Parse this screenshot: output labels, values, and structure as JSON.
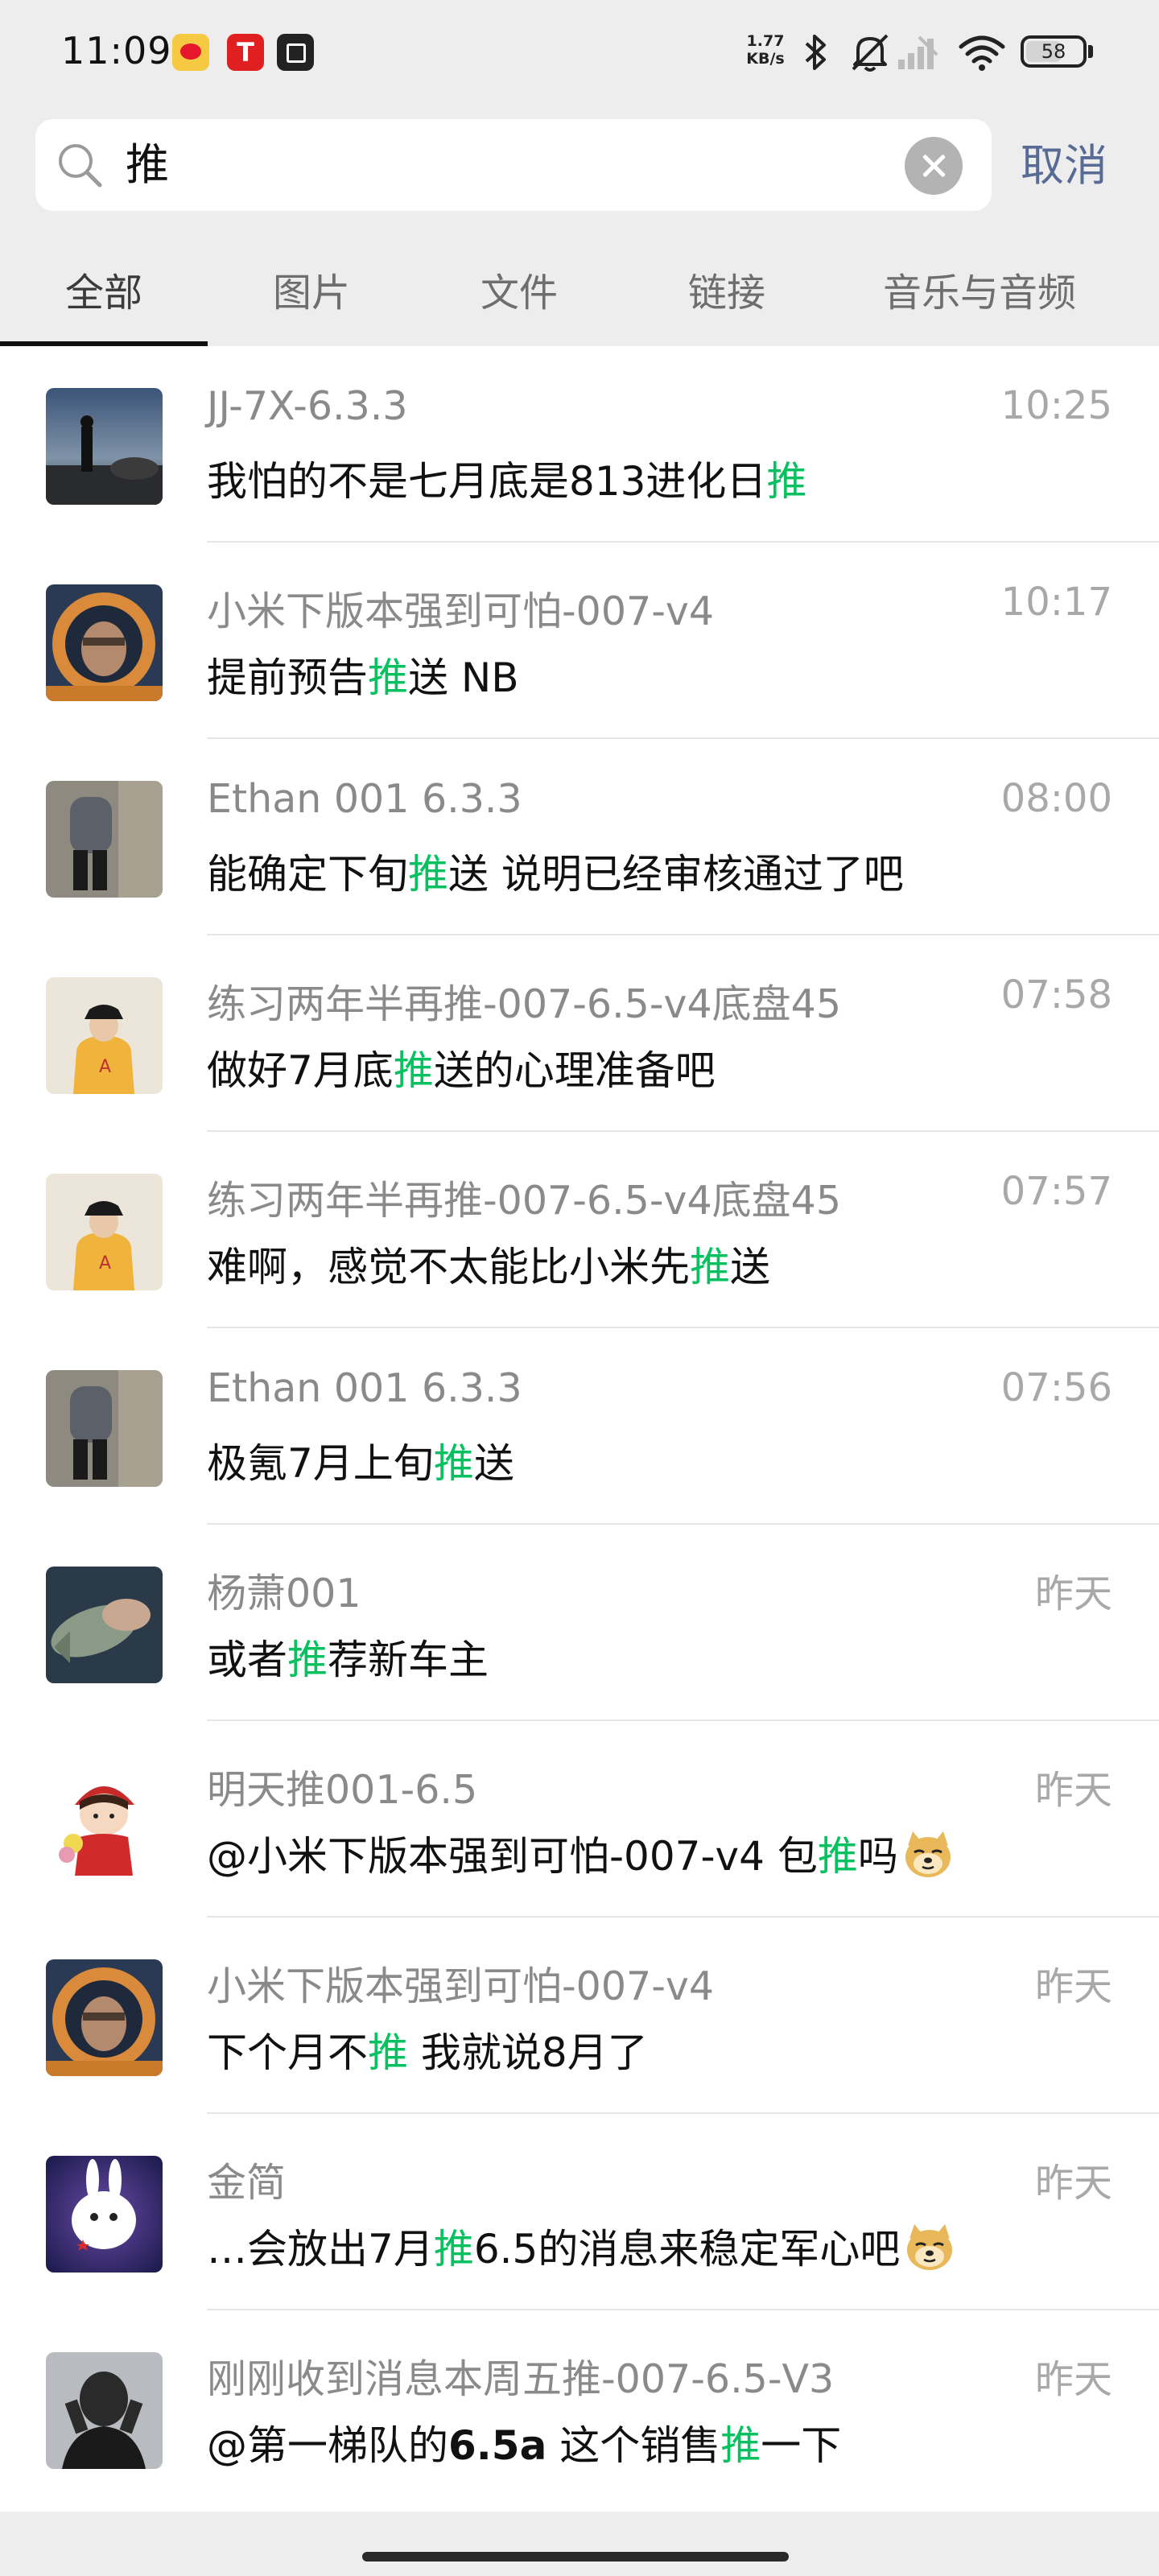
{
  "status_bar": {
    "time": "11:09",
    "net_speed_value": "1.77",
    "net_speed_unit": "KB/s",
    "battery": "58",
    "icons": [
      "weibo-app-icon",
      "tesla-app-icon",
      "box-app-icon",
      "bluetooth-icon",
      "mute-bell-icon",
      "cellular-signal-icon",
      "wifi-icon",
      "battery-icon"
    ]
  },
  "search": {
    "query": "推",
    "cancel_label": "取消"
  },
  "tabs": [
    {
      "label": "全部",
      "active": true
    },
    {
      "label": "图片",
      "active": false
    },
    {
      "label": "文件",
      "active": false
    },
    {
      "label": "链接",
      "active": false
    },
    {
      "label": "音乐与音频",
      "active": false
    }
  ],
  "colors": {
    "highlight": "#07c160",
    "accent": "#576b95"
  },
  "results": [
    {
      "name": "JJ-7X-6.3.3",
      "time": "10:25",
      "msg_pre": "我怕的不是七月底是813进化日",
      "msg_hl": "推",
      "msg_post": ""
    },
    {
      "name": "小米下版本强到可怕-007-v4",
      "time": "10:17",
      "msg_pre": "提前预告",
      "msg_hl": "推",
      "msg_post": "送 NB"
    },
    {
      "name": "Ethan 001 6.3.3",
      "time": "08:00",
      "msg_pre": "能确定下旬",
      "msg_hl": "推",
      "msg_post": "送 说明已经审核通过了吧"
    },
    {
      "name": "练习两年半再推-007-6.5-v4底盘45",
      "time": "07:58",
      "msg_pre": "做好7月底",
      "msg_hl": "推",
      "msg_post": "送的心理准备吧"
    },
    {
      "name": "练习两年半再推-007-6.5-v4底盘45",
      "time": "07:57",
      "msg_pre": "难啊，感觉不太能比小米先",
      "msg_hl": "推",
      "msg_post": "送"
    },
    {
      "name": "Ethan 001 6.3.3",
      "time": "07:56",
      "msg_pre": "极氪7月上旬",
      "msg_hl": "推",
      "msg_post": "送"
    },
    {
      "name": "杨萧001",
      "time": "昨天",
      "msg_pre": "或者",
      "msg_hl": "推",
      "msg_post": "荐新车主"
    },
    {
      "name": "明天推001-6.5",
      "time": "昨天",
      "msg_pre": "@小米下版本强到可怕-007-v4 包",
      "msg_hl": "推",
      "msg_post": "吗"
    },
    {
      "name": "小米下版本强到可怕-007-v4",
      "time": "昨天",
      "msg_pre": "下个月不",
      "msg_hl": "推",
      "msg_post": " 我就说8月了"
    },
    {
      "name": "金简",
      "time": "昨天",
      "msg_pre": "…会放出7月",
      "msg_hl": "推",
      "msg_post": "6.5的消息来稳定军心吧"
    },
    {
      "name": "刚刚收到消息本周五推-007-6.5-V3",
      "time": "昨天",
      "msg_pre": "@第一梯队的",
      "msg_bold": "6.5a",
      "msg_mid": " 这个销售",
      "msg_hl": "推",
      "msg_post": "一下"
    }
  ]
}
